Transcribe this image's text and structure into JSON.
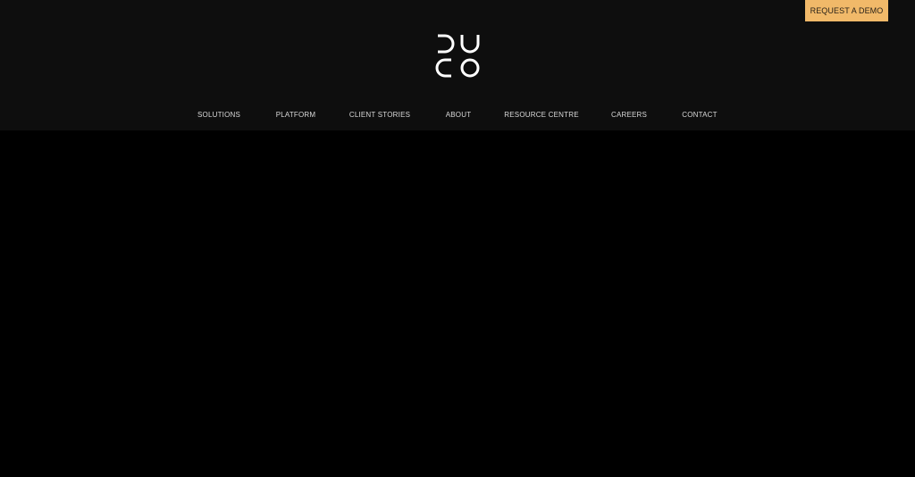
{
  "header": {
    "cta_label": "REQUEST A DEMO",
    "logo_alt": "DUCO"
  },
  "nav": {
    "items": [
      {
        "label": "SOLUTIONS"
      },
      {
        "label": "PLATFORM"
      },
      {
        "label": "CLIENT STORIES"
      },
      {
        "label": "ABOUT"
      },
      {
        "label": "RESOURCE CENTRE"
      },
      {
        "label": "CAREERS"
      },
      {
        "label": "CONTACT"
      }
    ]
  },
  "colors": {
    "header_bg": "#0e0e0e",
    "page_bg": "#000000",
    "cta_bg": "#f1b969",
    "nav_text": "#d9d9d9"
  }
}
